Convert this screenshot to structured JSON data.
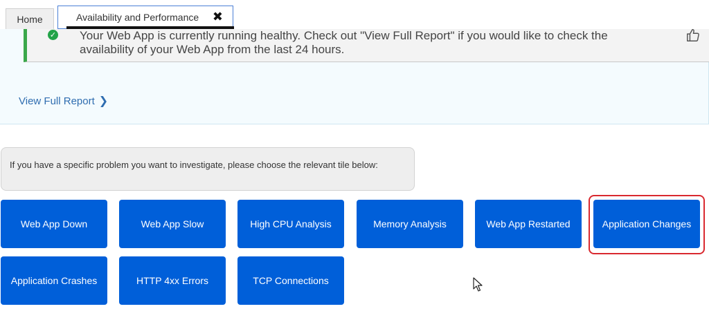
{
  "tabs": {
    "home_label": "Home",
    "active_label": "Availability and Performance",
    "close_glyph": "✖"
  },
  "status": {
    "message": "Your Web App is currently running healthy. Check out \"View Full Report\" if you would like to check the availability of your Web App from the last 24 hours.",
    "icon": "check-circle-icon",
    "color": "#23a348"
  },
  "report_link": {
    "label": "View Full Report",
    "chevron": "❯"
  },
  "instructions": {
    "text": "If you have a specific problem you want to investigate, please choose the relevant tile below:"
  },
  "tiles": [
    {
      "label": "Web App Down"
    },
    {
      "label": "Web App Slow"
    },
    {
      "label": "High CPU Analysis"
    },
    {
      "label": "Memory Analysis"
    },
    {
      "label": "Web App Restarted"
    },
    {
      "label": "Application Changes",
      "highlighted": true
    },
    {
      "label": "Application Crashes"
    },
    {
      "label": "HTTP 4xx Errors"
    },
    {
      "label": "TCP Connections"
    }
  ],
  "colors": {
    "tile": "#005fd9",
    "highlight": "#d9282f",
    "link": "#2f6db0"
  }
}
